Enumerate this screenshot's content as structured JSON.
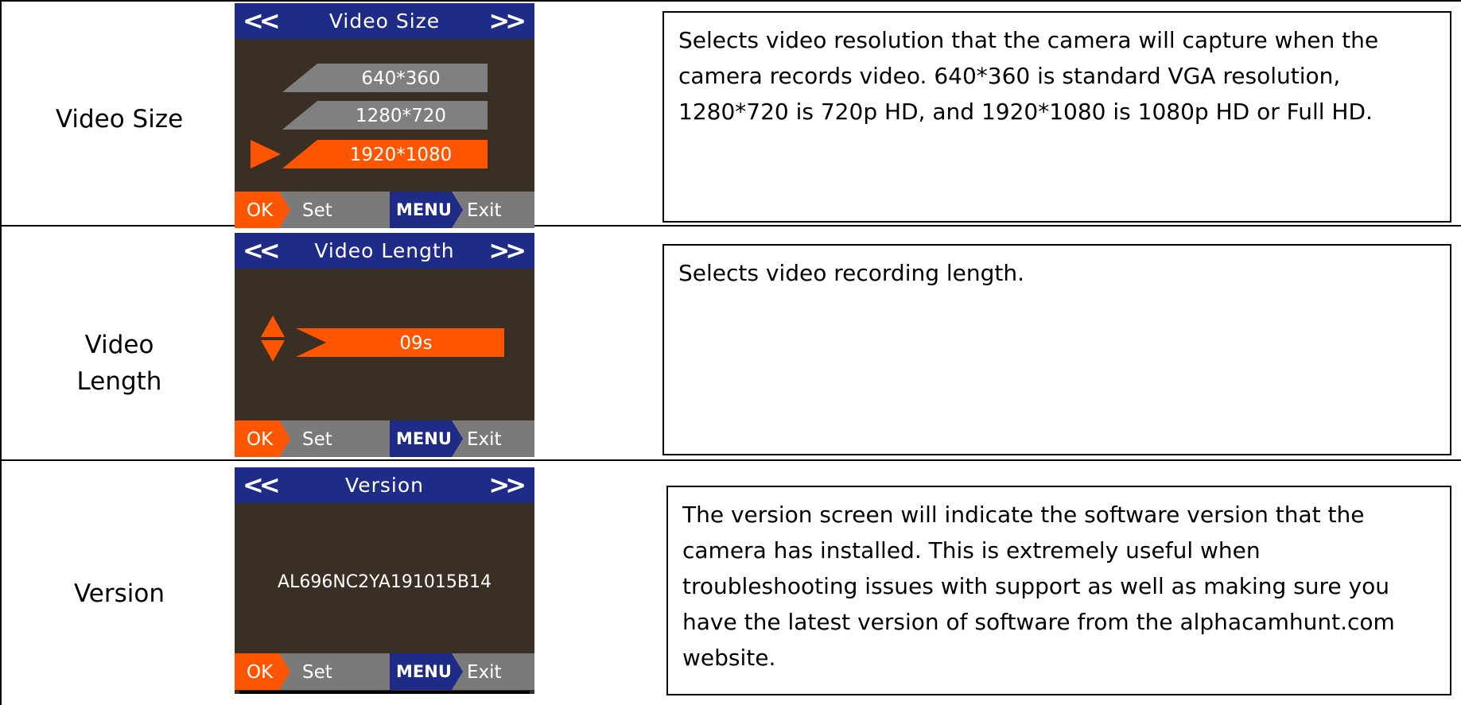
{
  "rows": [
    {
      "label": "Video Size",
      "screen": {
        "nav_left": "<<",
        "title": "Video Size",
        "nav_right": ">>",
        "options": [
          "640*360",
          "1280*720",
          "1920*1080"
        ],
        "selected": "1920*1080",
        "footer": {
          "ok": "OK",
          "set": "Set",
          "menu": "MENU",
          "exit": "Exit"
        }
      },
      "description": "Selects video resolution that the camera will capture when the camera records video.  640*360 is standard VGA resolution, 1280*720 is 720p HD, and 1920*1080 is 1080p HD or Full HD."
    },
    {
      "label_line1": "Video",
      "label_line2": "Length",
      "screen": {
        "nav_left": "<<",
        "title": "Video Length",
        "nav_right": ">>",
        "value": "09s",
        "footer": {
          "ok": "OK",
          "set": "Set",
          "menu": "MENU",
          "exit": "Exit"
        }
      },
      "description": "Selects video recording length."
    },
    {
      "label": "Version",
      "screen": {
        "nav_left": "<<",
        "title": "Version",
        "nav_right": ">>",
        "version": "AL696NC2YA191015B14",
        "footer": {
          "ok": "OK",
          "set": "Set",
          "menu": "MENU",
          "exit": "Exit"
        }
      },
      "description": "The version screen will indicate the software version that the camera has installed.  This is extremely useful when troubleshooting issues with support as well as making sure you have the latest version of software from the alphacamhunt.com website."
    }
  ],
  "colors": {
    "accent": "#ff5500",
    "title_bar": "#1e2b87",
    "screen_bg": "#3a2f25",
    "option_gray": "#808080",
    "footer_gray": "#7a7a7a"
  }
}
